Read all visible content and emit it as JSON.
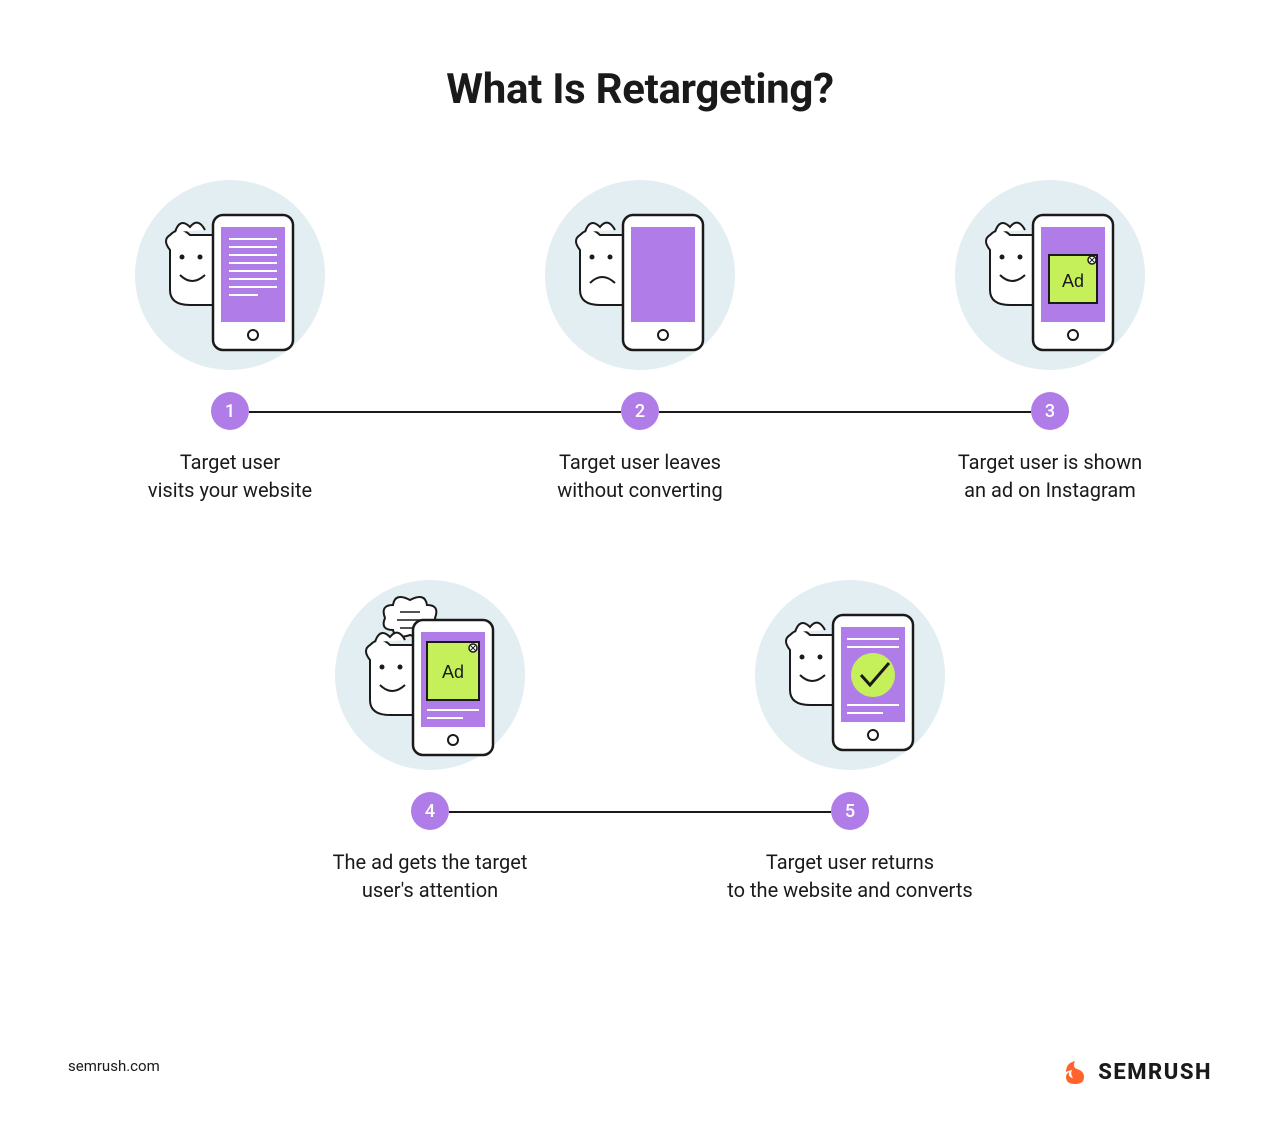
{
  "title": "What Is Retargeting?",
  "steps": [
    {
      "num": "1",
      "caption": "Target user\nvisits your website"
    },
    {
      "num": "2",
      "caption": "Target user leaves\nwithout converting"
    },
    {
      "num": "3",
      "caption": "Target user is shown\nan ad on Instagram"
    },
    {
      "num": "4",
      "caption": "The ad gets the target\nuser's attention"
    },
    {
      "num": "5",
      "caption": "Target user returns\nto the website and converts"
    }
  ],
  "ad_label": "Ad",
  "footer_url": "semrush.com",
  "brand": "SEMRUSH"
}
